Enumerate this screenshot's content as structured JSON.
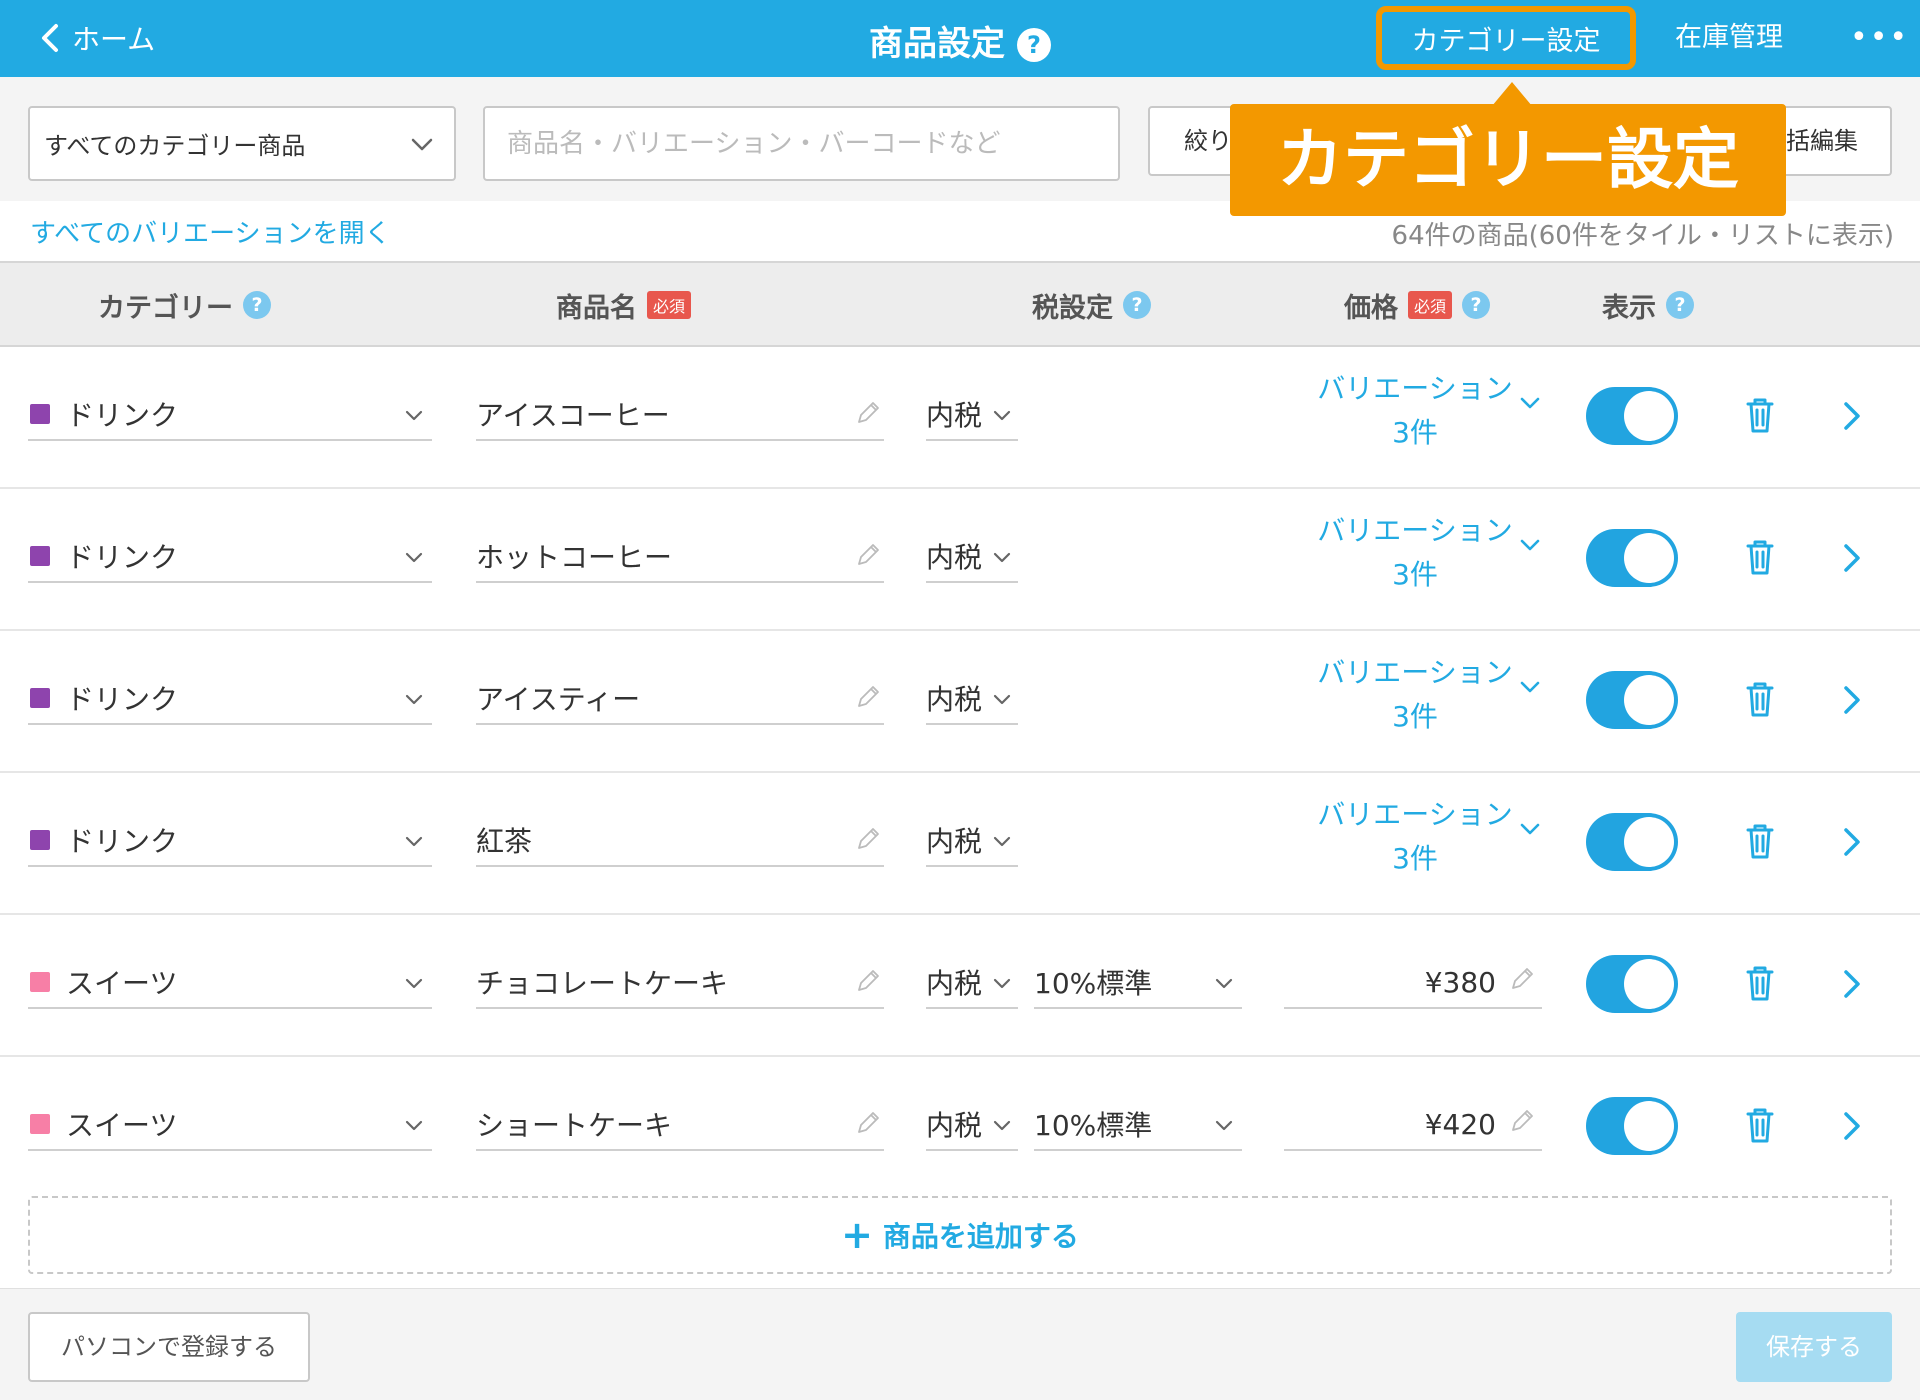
{
  "header": {
    "back_label": "ホーム",
    "title": "商品設定",
    "help": "?",
    "category_settings": "カテゴリー設定",
    "stock_management": "在庫管理",
    "more": "•••"
  },
  "filters": {
    "category_select": "すべてのカテゴリー商品",
    "search_placeholder": "商品名・バリエーション・バーコードなど",
    "filter_button": "絞り",
    "bulk_edit_button": "括編集"
  },
  "tooltip": {
    "text": "カテゴリー設定"
  },
  "info": {
    "expand_all": "すべてのバリエーションを開く",
    "count": "64件の商品(60件をタイル・リストに表示)"
  },
  "table": {
    "headers": {
      "category": "カテゴリー",
      "name": "商品名",
      "required": "必須",
      "tax": "税設定",
      "price": "価格",
      "price_required": "必須",
      "display": "表示"
    },
    "rows": [
      {
        "category": "ドリンク",
        "category_color": "#8e44ad",
        "name": "アイスコーヒー",
        "tax": "内税",
        "variation_label": "バリエーション",
        "variation_count": "3件",
        "visible": true
      },
      {
        "category": "ドリンク",
        "category_color": "#8e44ad",
        "name": "ホットコーヒー",
        "tax": "内税",
        "variation_label": "バリエーション",
        "variation_count": "3件",
        "visible": true
      },
      {
        "category": "ドリンク",
        "category_color": "#8e44ad",
        "name": "アイスティー",
        "tax": "内税",
        "variation_label": "バリエーション",
        "variation_count": "3件",
        "visible": true
      },
      {
        "category": "ドリンク",
        "category_color": "#8e44ad",
        "name": "紅茶",
        "tax": "内税",
        "variation_label": "バリエーション",
        "variation_count": "3件",
        "visible": true
      },
      {
        "category": "スイーツ",
        "category_color": "#f77fa6",
        "name": "チョコレートケーキ",
        "tax": "内税",
        "tax_rate": "10%標準",
        "price": "¥380",
        "visible": true
      },
      {
        "category": "スイーツ",
        "category_color": "#f77fa6",
        "name": "ショートケーキ",
        "tax": "内税",
        "tax_rate": "10%標準",
        "price": "¥420",
        "visible": true
      }
    ]
  },
  "add_product": {
    "plus": "+",
    "label": "商品を追加する"
  },
  "footer": {
    "register_pc": "パソコンで登録する",
    "save": "保存する"
  },
  "colors": {
    "brand": "#22aae2",
    "accent_orange": "#f39800",
    "required_red": "#e8574d"
  }
}
